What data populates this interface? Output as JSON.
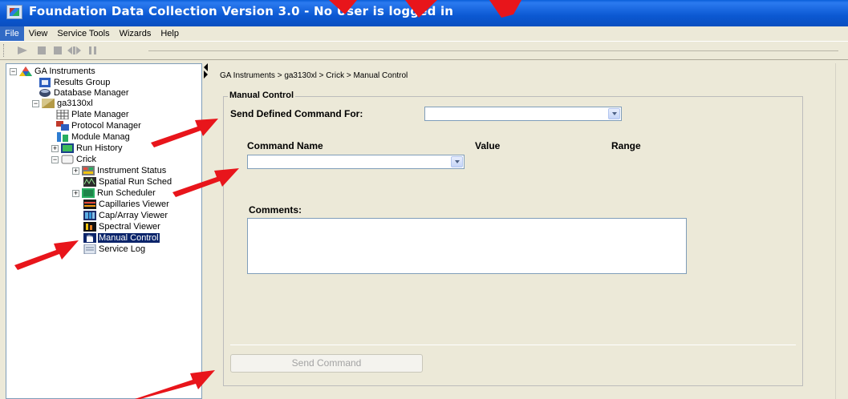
{
  "window": {
    "title": "Foundation Data Collection Version 3.0     -     No User is logged in"
  },
  "menu": {
    "items": [
      "File",
      "View",
      "Service Tools",
      "Wizards",
      "Help"
    ]
  },
  "toolbar": {
    "buttons": [
      "play-icon",
      "stop-icon",
      "pause-icon",
      "step-icon",
      "bars-icon"
    ]
  },
  "tree": {
    "items": [
      {
        "label": "GA Instruments",
        "icon": "triangle-icon",
        "expander": "−"
      },
      {
        "label": "Results Group",
        "icon": "results-group-icon"
      },
      {
        "label": "Database Manager",
        "icon": "database-icon"
      },
      {
        "label": "ga3130xl",
        "icon": "instrument-icon",
        "expander": "−"
      },
      {
        "label": "Plate Manager",
        "icon": "plate-icon"
      },
      {
        "label": "Protocol Manager",
        "icon": "protocol-icon"
      },
      {
        "label": "Module Manag",
        "icon": "module-icon"
      },
      {
        "label": "Run History",
        "icon": "history-icon",
        "expander": "+"
      },
      {
        "label": "Crick",
        "icon": "folder-icon",
        "expander": "−"
      },
      {
        "label": "Instrument Status",
        "icon": "status-icon",
        "expander": "+"
      },
      {
        "label": "Spatial Run Sched",
        "icon": "spatial-icon"
      },
      {
        "label": "Run Scheduler",
        "icon": "scheduler-icon",
        "expander": "+"
      },
      {
        "label": "Capillaries Viewer",
        "icon": "capillaries-icon"
      },
      {
        "label": "Cap/Array Viewer",
        "icon": "array-icon"
      },
      {
        "label": "Spectral Viewer",
        "icon": "spectral-icon"
      },
      {
        "label": "Manual Control",
        "icon": "hand-icon",
        "selected": true
      },
      {
        "label": "Service Log",
        "icon": "log-icon"
      }
    ]
  },
  "main": {
    "breadcrumb": "GA Instruments > ga3130xl > Crick > Manual Control",
    "group_title": "Manual Control",
    "send_defined_label": "Send Defined Command For:",
    "command_name_label": "Command Name",
    "value_label": "Value",
    "range_label": "Range",
    "comments_label": "Comments:",
    "send_button": "Send Command"
  },
  "colors": {
    "titlebar": "#0b58d2",
    "selection": "#0a246a",
    "annotation": "#e8151b"
  }
}
